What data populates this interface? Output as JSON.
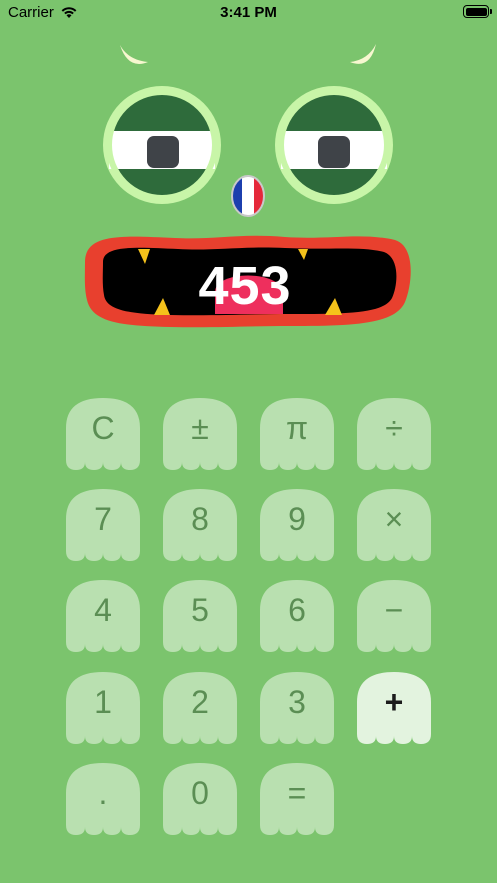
{
  "status_bar": {
    "carrier": "Carrier",
    "time": "3:41 PM"
  },
  "display": {
    "value": "453"
  },
  "flag_icon": "french-flag-icon",
  "keypad": {
    "rows": [
      [
        {
          "label": "C",
          "name": "clear-button"
        },
        {
          "label": "±",
          "name": "plus-minus-button"
        },
        {
          "label": "π",
          "name": "pi-button"
        },
        {
          "label": "÷",
          "name": "divide-button"
        }
      ],
      [
        {
          "label": "7",
          "name": "seven-button"
        },
        {
          "label": "8",
          "name": "eight-button"
        },
        {
          "label": "9",
          "name": "nine-button"
        },
        {
          "label": "×",
          "name": "multiply-button"
        }
      ],
      [
        {
          "label": "4",
          "name": "four-button"
        },
        {
          "label": "5",
          "name": "five-button"
        },
        {
          "label": "6",
          "name": "six-button"
        },
        {
          "label": "−",
          "name": "minus-button"
        }
      ],
      [
        {
          "label": "1",
          "name": "one-button"
        },
        {
          "label": "2",
          "name": "two-button"
        },
        {
          "label": "3",
          "name": "three-button"
        },
        {
          "label": "+",
          "name": "plus-button",
          "active": true
        }
      ],
      [
        {
          "label": ".",
          "name": "decimal-button"
        },
        {
          "label": "0",
          "name": "zero-button"
        },
        {
          "label": "=",
          "name": "equals-button"
        }
      ]
    ]
  },
  "colors": {
    "background": "#7bc46d",
    "key": "#b9e0b0",
    "key_active": "#e3f3df",
    "key_text": "#5b8e54",
    "eye_ring": "#c8f5a8",
    "eye_band": "#2e6b3b",
    "mouth_outer": "#e8402e",
    "tongue": "#ee2f5d",
    "teeth": "#f5c21b"
  }
}
